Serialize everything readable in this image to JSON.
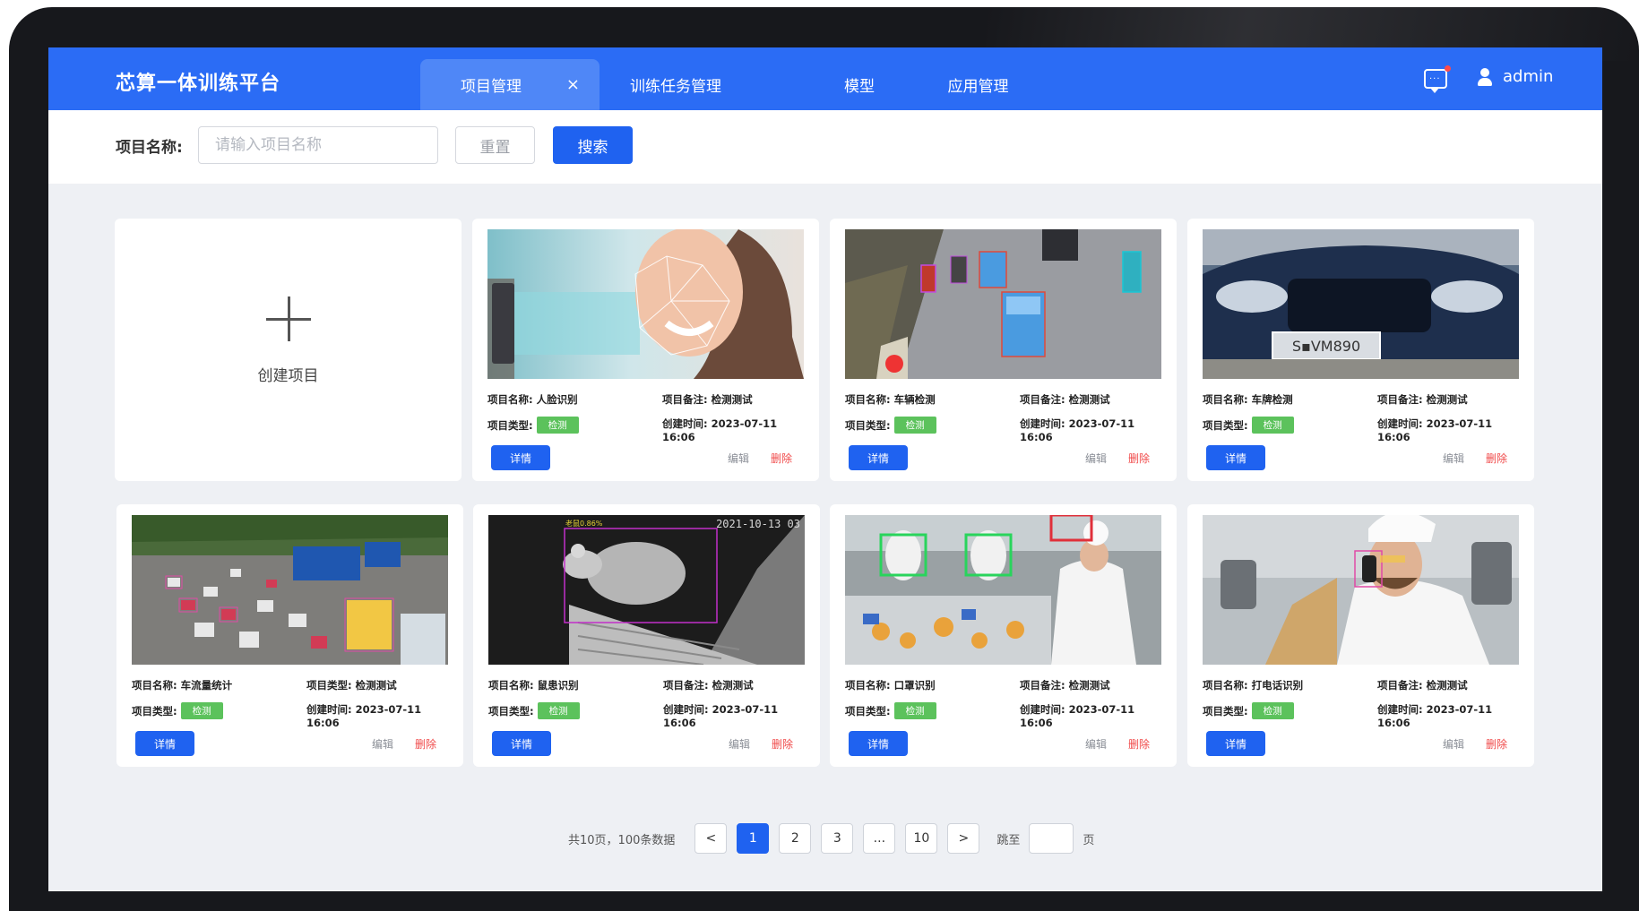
{
  "header": {
    "brand": "芯算一体训练平台",
    "tabs": [
      {
        "label": "项目管理",
        "active": true
      },
      {
        "label": "训练任务管理"
      },
      {
        "label": "模型"
      },
      {
        "label": "应用管理"
      }
    ],
    "tab_close": "×",
    "username": "admin",
    "icons": {
      "chat": "chat-icon",
      "user": "user-icon"
    }
  },
  "search": {
    "label": "项目名称:",
    "placeholder": "请输入项目名称",
    "reset": "重置",
    "submit": "搜索"
  },
  "create": {
    "label": "创建项目"
  },
  "labels": {
    "name": "项目名称:",
    "type": "项目类型:",
    "note": "项目备注:",
    "created": "创建时间:",
    "detail": "详情",
    "edit": "编辑",
    "delete": "删除"
  },
  "projects": [
    {
      "name": "人脸识别",
      "note_label": "项目备注:",
      "note": "检测测试",
      "type_tag": "检测",
      "created": "2023-07-11 16:06"
    },
    {
      "name": "车辆检测",
      "note_label": "项目备注:",
      "note": "检测测试",
      "type_tag": "检测",
      "created": "2023-07-11 16:06"
    },
    {
      "name": "车牌检测",
      "note_label": "项目备注:",
      "note": "检测测试",
      "type_tag": "检测",
      "created": "2023-07-11 16:06"
    },
    {
      "name": "车流量统计",
      "note_label": "项目类型:",
      "note": "检测测试",
      "type_tag": "检测",
      "created": "2023-07-11 16:06"
    },
    {
      "name": "鼠患识别",
      "note_label": "项目备注:",
      "note": "检测测试",
      "type_tag": "检测",
      "created": "2023-07-11 16:06"
    },
    {
      "name": "口罩识别",
      "note_label": "项目备注:",
      "note": "检测测试",
      "type_tag": "检测",
      "created": "2023-07-11 16:06"
    },
    {
      "name": "打电话识别",
      "note_label": "项目备注:",
      "note": "检测测试",
      "type_tag": "检测",
      "created": "2023-07-11 16:06"
    }
  ],
  "image_text": {
    "plate": "S▪VM890",
    "rat_timestamp": "2021-10-13 03",
    "rat_label": "老鼠0.86%"
  },
  "pagination": {
    "summary": "共10页，100条数据",
    "prev": "<",
    "next": ">",
    "pages": [
      "1",
      "2",
      "3",
      "...",
      "10"
    ],
    "current": "1",
    "jump_label": "跳至",
    "page_suffix": "页"
  },
  "colors": {
    "primary": "#2b6cf5",
    "button": "#1f62f0",
    "tag": "#5cc25c",
    "delete": "#f04a4a"
  }
}
